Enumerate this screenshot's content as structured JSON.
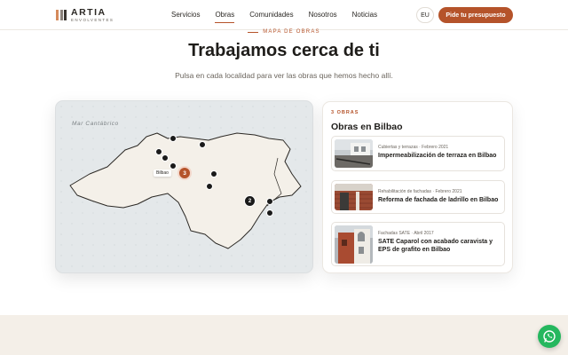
{
  "brand": {
    "name": "ARTIA",
    "tagline": "ENVOLVENTES",
    "bar_colors": [
      "#d58a5c",
      "#8a817a",
      "#3a3530"
    ]
  },
  "nav": {
    "items": [
      {
        "label": "Servicios"
      },
      {
        "label": "Obras"
      },
      {
        "label": "Comunidades"
      },
      {
        "label": "Nosotros"
      },
      {
        "label": "Noticias"
      }
    ],
    "active": "Obras",
    "lang": "EU",
    "cta": "Pide tu presupuesto"
  },
  "section": {
    "eyebrow": "MAPA DE OBRAS",
    "title": "Trabajamos cerca de ti",
    "subtitle": "Pulsa en cada localidad para ver las obras que hemos hecho allí."
  },
  "map": {
    "sea_label": "Mar Cantábrico",
    "selected_label": "Bilbao",
    "selected_count": "3",
    "cluster_count": "2"
  },
  "panel": {
    "count_label": "3 OBRAS",
    "title": "Obras en Bilbao",
    "items": [
      {
        "meta": "Cubiertas y terrazas · Febrero 2021",
        "title": "Impermeabilización de terraza en Bilbao"
      },
      {
        "meta": "Rehabilitación de fachadas · Febrero 2021",
        "title": "Reforma de fachada de ladrillo en Bilbao"
      },
      {
        "meta": "Fachadas SATE · Abril 2017",
        "title": "SATE Caparol con acabado caravista y EPS de grafito en Bilbao"
      }
    ]
  },
  "colors": {
    "accent": "#b5532a",
    "whatsapp": "#25b75e"
  }
}
